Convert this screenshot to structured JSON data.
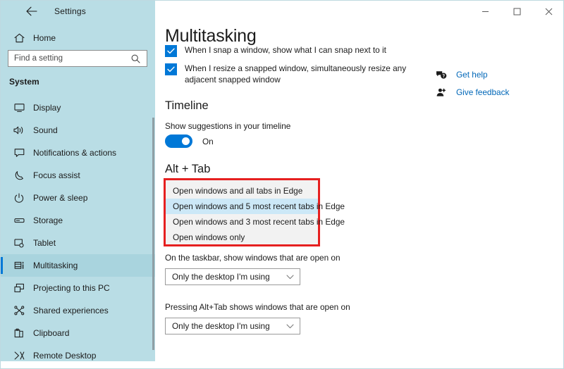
{
  "window": {
    "app_title": "Settings",
    "back_icon": "back-arrow-icon",
    "controls": {
      "minimize": "─",
      "maximize": "☐",
      "close": "✕"
    }
  },
  "sidebar": {
    "home": {
      "label": "Home",
      "icon": "home-icon"
    },
    "search": {
      "placeholder": "Find a setting",
      "value": "",
      "icon": "search-icon"
    },
    "section_title": "System",
    "items": [
      {
        "label": "Display",
        "icon": "display-icon",
        "selected": false
      },
      {
        "label": "Sound",
        "icon": "sound-icon",
        "selected": false
      },
      {
        "label": "Notifications & actions",
        "icon": "notifications-icon",
        "selected": false
      },
      {
        "label": "Focus assist",
        "icon": "moon-icon",
        "selected": false
      },
      {
        "label": "Power & sleep",
        "icon": "power-icon",
        "selected": false
      },
      {
        "label": "Storage",
        "icon": "storage-icon",
        "selected": false
      },
      {
        "label": "Tablet",
        "icon": "tablet-icon",
        "selected": false
      },
      {
        "label": "Multitasking",
        "icon": "multitasking-icon",
        "selected": true
      },
      {
        "label": "Projecting to this PC",
        "icon": "projecting-icon",
        "selected": false
      },
      {
        "label": "Shared experiences",
        "icon": "shared-experiences-icon",
        "selected": false
      },
      {
        "label": "Clipboard",
        "icon": "clipboard-icon",
        "selected": false
      },
      {
        "label": "Remote Desktop",
        "icon": "remote-desktop-icon",
        "selected": false
      }
    ]
  },
  "main": {
    "page_title": "Multitasking",
    "snap": {
      "checkbox_1": {
        "label": "When I snap a window, show what I can snap next to it",
        "checked": true
      },
      "checkbox_2": {
        "label": "When I resize a snapped window, simultaneously resize any adjacent snapped window",
        "checked": true
      }
    },
    "timeline": {
      "heading": "Timeline",
      "toggle_label": "Show suggestions in your timeline",
      "toggle_state": "On",
      "toggle_on": true
    },
    "alt_tab": {
      "heading": "Alt + Tab",
      "options": [
        {
          "label": "Open windows and all tabs in Edge",
          "highlighted": false
        },
        {
          "label": "Open windows and 5 most recent tabs in Edge",
          "highlighted": true
        },
        {
          "label": "Open windows and 3 most recent tabs in Edge",
          "highlighted": false
        },
        {
          "label": "Open windows only",
          "highlighted": false
        }
      ],
      "highlight_border_color": "#e62020",
      "selection_color": "#cce8f7"
    },
    "taskbar_setting": {
      "label": "On the taskbar, show windows that are open on",
      "value": "Only the desktop I'm using"
    },
    "alttab_setting": {
      "label": "Pressing Alt+Tab shows windows that are open on",
      "value": "Only the desktop I'm using"
    }
  },
  "help": {
    "links": [
      {
        "label": "Get help",
        "icon": "get-help-icon"
      },
      {
        "label": "Give feedback",
        "icon": "give-feedback-icon"
      }
    ]
  },
  "colors": {
    "accent": "#0078d7",
    "sidebar": "#b9dde5",
    "link": "#0067b8",
    "highlight_red": "#e62020"
  }
}
